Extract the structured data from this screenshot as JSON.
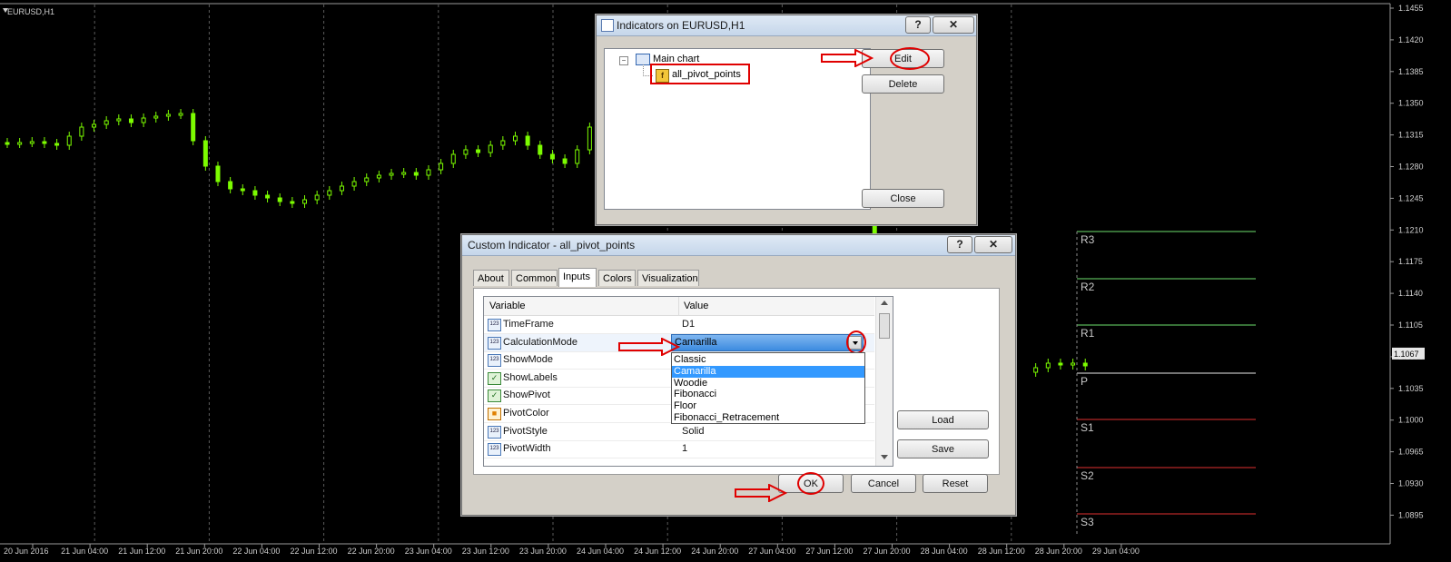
{
  "chart": {
    "symbol_label": "EURUSD,H1",
    "price_levels": [
      "1.1455",
      "1.1420",
      "1.1385",
      "1.1350",
      "1.1315",
      "1.1280",
      "1.1245",
      "1.1210",
      "1.1175",
      "1.1140",
      "1.1105",
      "1.1070",
      "1.1035",
      "1.1000",
      "1.0965",
      "1.0930",
      "1.0895"
    ],
    "current_price": "1.1067",
    "time_labels": [
      "20 Jun 2016",
      "21 Jun 04:00",
      "21 Jun 12:00",
      "21 Jun 20:00",
      "22 Jun 04:00",
      "22 Jun 12:00",
      "22 Jun 20:00",
      "23 Jun 04:00",
      "23 Jun 12:00",
      "23 Jun 20:00",
      "24 Jun 04:00",
      "24 Jun 12:00",
      "24 Jun 20:00",
      "27 Jun 04:00",
      "27 Jun 12:00",
      "27 Jun 20:00",
      "28 Jun 04:00",
      "28 Jun 12:00",
      "28 Jun 20:00",
      "29 Jun 04:00"
    ],
    "pivot_labels": [
      "R3",
      "R2",
      "R1",
      "P",
      "S1",
      "S2",
      "S3"
    ],
    "colors": {
      "bull": "#7cfc00",
      "bear": "#7cfc00",
      "resistance": "#6ee06e",
      "support": "#e03030",
      "pivot": "#e8e8e8",
      "grid": "#5a5a5a"
    }
  },
  "indicators_dialog": {
    "title": "Indicators on EURUSD,H1",
    "help_button": "?",
    "close_x": "✕",
    "tree_root": "Main chart",
    "tree_item": "all_pivot_points",
    "edit_button": "Edit",
    "delete_button": "Delete",
    "close_button": "Close"
  },
  "custom_dialog": {
    "title": "Custom Indicator - all_pivot_points",
    "help_button": "?",
    "close_x": "✕",
    "tabs": [
      "About",
      "Common",
      "Inputs",
      "Colors",
      "Visualization"
    ],
    "active_tab": "Inputs",
    "columns": {
      "variable": "Variable",
      "value": "Value"
    },
    "rows": [
      {
        "name": "TimeFrame",
        "value": "D1",
        "icon": "int-icon"
      },
      {
        "name": "CalculationMode",
        "value": "Camarilla",
        "icon": "int-icon"
      },
      {
        "name": "ShowMode",
        "value": "",
        "icon": "int-icon"
      },
      {
        "name": "ShowLabels",
        "value": "",
        "icon": "bool-icon"
      },
      {
        "name": "ShowPivot",
        "value": "",
        "icon": "bool-icon"
      },
      {
        "name": "PivotColor",
        "value": "",
        "icon": "color-icon"
      },
      {
        "name": "PivotStyle",
        "value": "Solid",
        "icon": "int-icon"
      },
      {
        "name": "PivotWidth",
        "value": "1",
        "icon": "int-icon"
      }
    ],
    "dropdown_value": "Camarilla",
    "dropdown_options": [
      "Classic",
      "Camarilla",
      "Woodie",
      "Fibonacci",
      "Floor",
      "Fibonacci_Retracement"
    ],
    "dropdown_selected": "Camarilla",
    "load_button": "Load",
    "save_button": "Save",
    "ok_button": "OK",
    "cancel_button": "Cancel",
    "reset_button": "Reset"
  }
}
